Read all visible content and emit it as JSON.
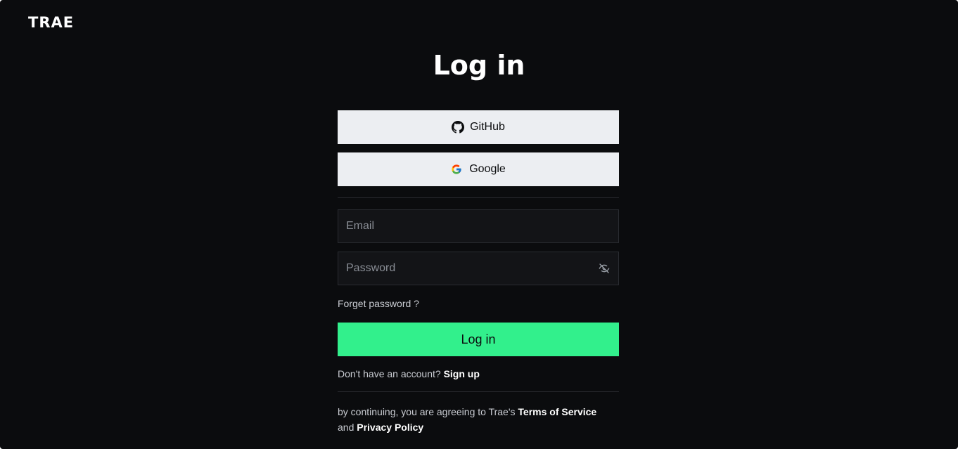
{
  "brand": {
    "logo_text": "TRAE"
  },
  "page": {
    "title": "Log in"
  },
  "oauth": {
    "github_label": "GitHub",
    "google_label": "Google",
    "github_icon": "github-icon",
    "google_icon": "google-icon"
  },
  "form": {
    "email_placeholder": "Email",
    "email_value": "",
    "password_placeholder": "Password",
    "password_value": "",
    "password_toggle_icon": "eye-off-icon",
    "forgot_label": "Forget password ?",
    "submit_label": "Log in"
  },
  "signup": {
    "prompt": "Don't have an account?",
    "link_label": "Sign up"
  },
  "legal": {
    "prefix": "by continuing, you are agreeing to Trae's",
    "terms_label": "Terms of Service",
    "and": "and",
    "privacy_label": "Privacy Policy"
  },
  "colors": {
    "background": "#0b0c0e",
    "accent": "#32f08c",
    "oauth_button": "#eceef2",
    "input_background": "#131417"
  }
}
